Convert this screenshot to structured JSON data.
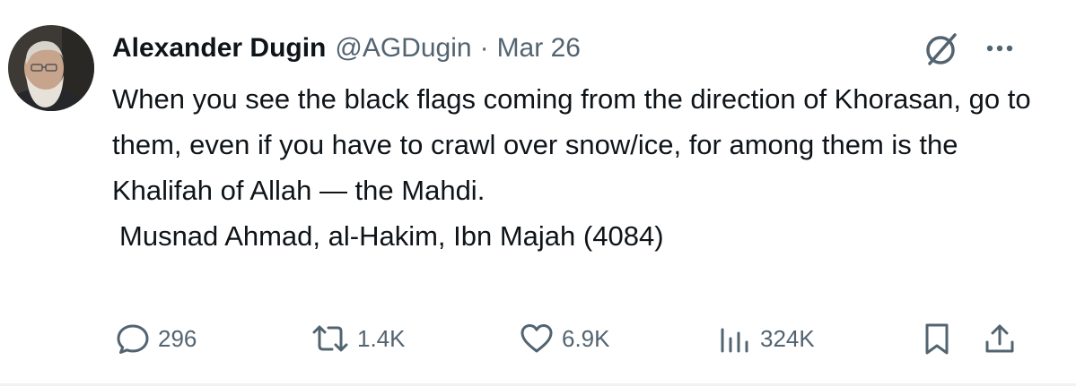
{
  "author": {
    "name": "Alexander Dugin",
    "handle": "@AGDugin",
    "separator": "·",
    "date": "Mar 26"
  },
  "tweet": {
    "paragraphs": [
      "When you see the black flags coming from the direction of Khorasan, go to them, even if you have to crawl over snow/ice, for among them is the Khalifah of Allah — the Mahdi.",
      "Musnad Ahmad, al-Hakim, Ibn Majah (4084)"
    ]
  },
  "actions": {
    "replies": "296",
    "reposts": "1.4K",
    "likes": "6.9K",
    "views": "324K"
  },
  "icons": {
    "grok": "grok-icon",
    "more": "more-icon",
    "reply": "reply-icon",
    "repost": "repost-icon",
    "like": "heart-icon",
    "views": "views-icon",
    "bookmark": "bookmark-icon",
    "share": "share-icon"
  },
  "colors": {
    "text_primary": "#0f1419",
    "text_secondary": "#536471",
    "background": "#ffffff"
  }
}
